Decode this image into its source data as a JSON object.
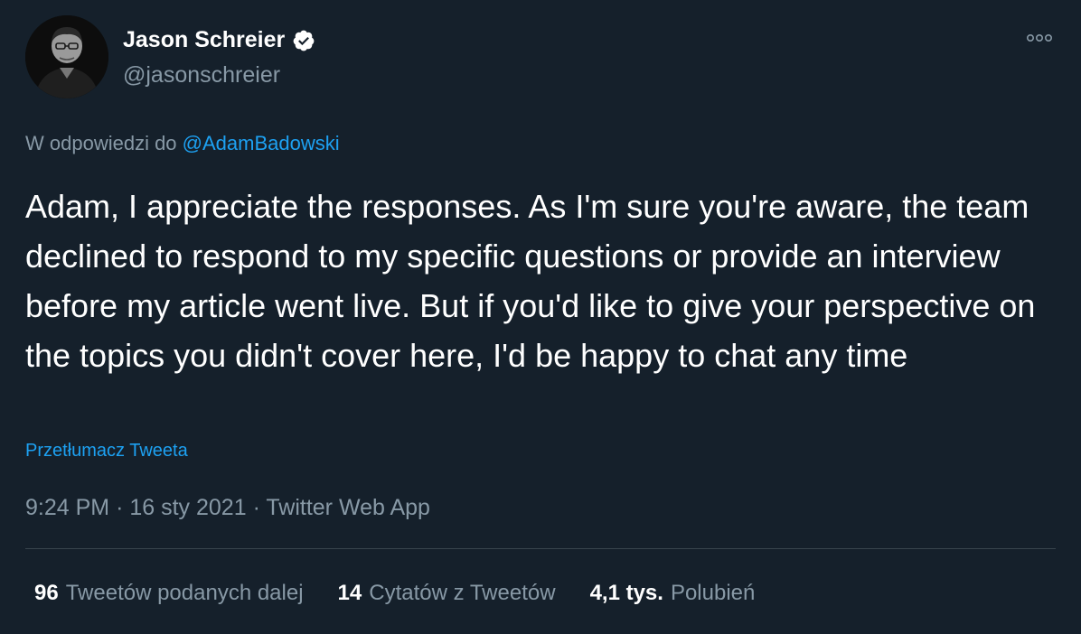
{
  "author": {
    "name": "Jason Schreier",
    "handle": "@jasonschreier",
    "verified": true
  },
  "reply": {
    "prefix": "W odpowiedzi do",
    "mention": "@AdamBadowski"
  },
  "tweet": {
    "text": "Adam, I appreciate the responses. As I'm sure you're aware, the team declined to respond to my specific questions or provide an interview before my article went live. But if you'd like to give your perspective on the topics you didn't cover here, I'd be happy to chat any time",
    "translate_label": "Przetłumacz Tweeta"
  },
  "meta": {
    "time": "9:24 PM",
    "date": "16 sty 2021",
    "separator": "·",
    "source": "Twitter Web App"
  },
  "stats": [
    {
      "value": "96",
      "label": "Tweetów podanych dalej"
    },
    {
      "value": "14",
      "label": "Cytatów z Tweetów"
    },
    {
      "value": "4,1 tys.",
      "label": "Polubień"
    }
  ],
  "icons": {
    "more": "more-horizontal-icon",
    "verified": "verified-badge-icon"
  },
  "colors": {
    "background": "#15202b",
    "accent": "#1da1f2",
    "secondary_text": "#8899a6",
    "divider": "#38444d"
  }
}
